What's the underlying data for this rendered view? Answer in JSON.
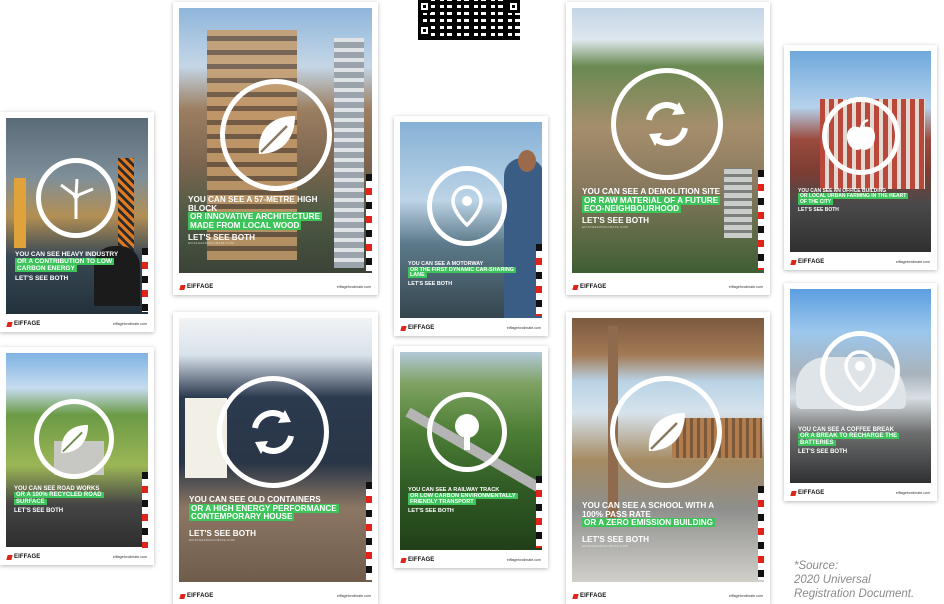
{
  "qr_code": "qr-code-icon",
  "brand": {
    "name": "EIFFAGE",
    "site": "eiffageforclimate.com"
  },
  "posters": [
    {
      "lead": "YOU CAN SEE A 57-METRE HIGH BLOCK",
      "highlight": "OR INNOVATIVE ARCHITECTURE MADE FROM LOCAL WOOD",
      "see": "LET'S SEE BOTH",
      "icon": "leaf-icon"
    },
    {
      "lead": "YOU CAN SEE HEAVY INDUSTRY",
      "highlight": "OR A CONTRIBUTION TO LOW CARBON ENERGY",
      "see": "LET'S SEE BOTH",
      "icon": "wind-turbine-icon"
    },
    {
      "lead": "YOU CAN SEE A MOTORWAY",
      "highlight": "OR THE FIRST DYNAMIC CAR-SHARING LANE",
      "see": "LET'S SEE BOTH",
      "icon": "location-pin-icon"
    },
    {
      "lead": "YOU CAN SEE A DEMOLITION SITE",
      "highlight": "OR RAW MATERIAL OF A FUTURE ECO-NEIGHBOURHOOD",
      "see": "LET'S SEE BOTH",
      "icon": "recycle-icon"
    },
    {
      "lead": "YOU CAN SEE AN OFFICE BUILDING",
      "highlight": "OR LOCAL URBAN FARMING IN THE HEART OF THE CITY",
      "see": "LET'S SEE BOTH",
      "icon": "apple-icon"
    },
    {
      "lead": "YOU CAN SEE ROAD WORKS",
      "highlight": "OR A 100% RECYCLED ROAD SURFACE",
      "see": "LET'S SEE BOTH",
      "icon": "leaf-icon"
    },
    {
      "lead": "YOU CAN SEE OLD CONTAINERS",
      "highlight": "OR A HIGH ENERGY PERFORMANCE CONTEMPORARY HOUSE",
      "see": "LET'S SEE BOTH",
      "icon": "recycle-icon"
    },
    {
      "lead": "YOU CAN SEE A RAILWAY TRACK",
      "highlight": "OR LOW CARBON ENVIRONMENTALLY FRIENDLY TRANSPORT",
      "see": "LET'S SEE BOTH",
      "icon": "tree-icon"
    },
    {
      "lead": "YOU CAN SEE A SCHOOL WITH A 100% PASS RATE",
      "highlight": "OR A ZERO EMISSION BUILDING",
      "see": "LET'S SEE BOTH",
      "icon": "leaf-icon"
    },
    {
      "lead": "YOU CAN SEE A COFFEE BREAK",
      "highlight": "OR A BREAK TO RECHARGE THE BATTERIES",
      "see": "LET'S SEE BOTH",
      "icon": "location-pin-icon"
    }
  ],
  "source": {
    "line1": "*Source:",
    "line2": "2020 Universal",
    "line3": "Registration Document."
  }
}
